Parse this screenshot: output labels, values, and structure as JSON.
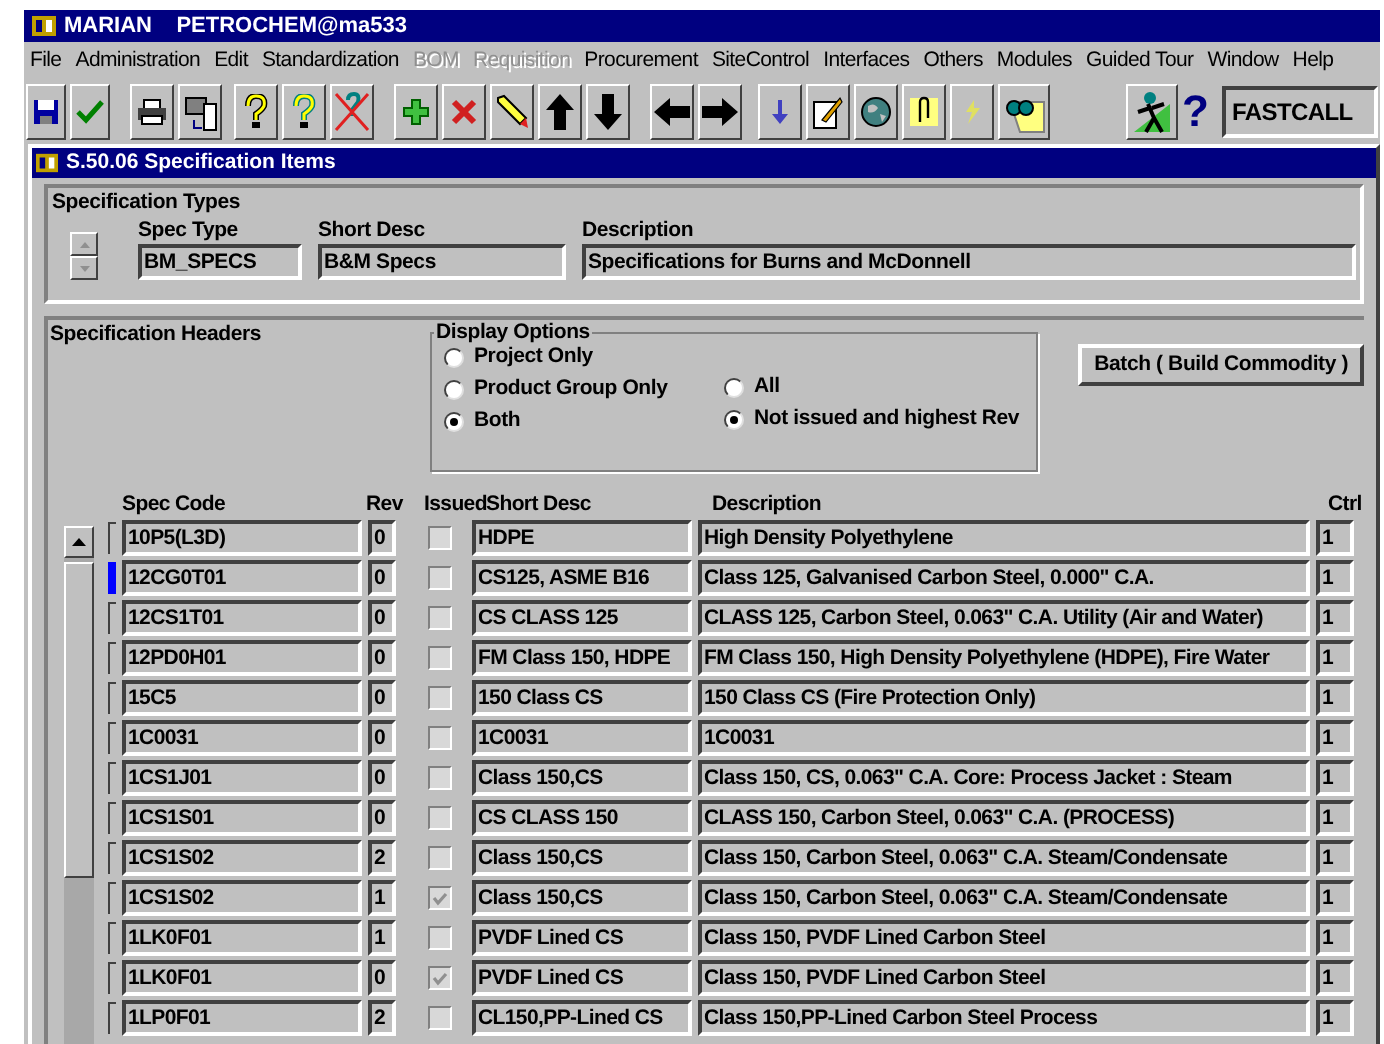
{
  "window": {
    "title": "MARIAN    PETROCHEM@ma533"
  },
  "menu": [
    {
      "label": "File",
      "disabled": false
    },
    {
      "label": "Administration",
      "disabled": false
    },
    {
      "label": "Edit",
      "disabled": false
    },
    {
      "label": "Standardization",
      "disabled": false
    },
    {
      "label": "BOM",
      "disabled": true
    },
    {
      "label": "Requisition",
      "disabled": true
    },
    {
      "label": "Procurement",
      "disabled": false
    },
    {
      "label": "SiteControl",
      "disabled": false
    },
    {
      "label": "Interfaces",
      "disabled": false
    },
    {
      "label": "Others",
      "disabled": false
    },
    {
      "label": "Modules",
      "disabled": false
    },
    {
      "label": "Guided Tour",
      "disabled": false
    },
    {
      "label": "Window",
      "disabled": false
    },
    {
      "label": "Help",
      "disabled": false
    }
  ],
  "toolbar": {
    "help_glyph": "?",
    "fastcall": "FASTCALL"
  },
  "form": {
    "title": "S.50.06 Specification Items",
    "spec_types": {
      "title": "Specification Types",
      "spec_type_label": "Spec Type",
      "spec_type": "BM_SPECS",
      "short_desc_label": "Short Desc",
      "short_desc": "B&M Specs",
      "description_label": "Description",
      "description": "Specifications for Burns and McDonnell"
    },
    "spec_headers": {
      "title": "Specification Headers",
      "display_options": {
        "title": "Display Options",
        "scope": [
          {
            "label": "Project Only",
            "selected": false
          },
          {
            "label": "Product Group Only",
            "selected": false
          },
          {
            "label": "Both",
            "selected": true
          }
        ],
        "issue": [
          {
            "label": "All",
            "selected": false
          },
          {
            "label": "Not issued and highest Rev",
            "selected": true
          }
        ]
      },
      "batch_button": "Batch ( Build Commodity )"
    },
    "table": {
      "columns": [
        "Spec Code",
        "Rev",
        "Issued",
        "Short Desc",
        "Description",
        "Ctrl"
      ],
      "rows": [
        {
          "spec_code": "10P5(L3D)",
          "rev": "0",
          "issued": false,
          "short_desc": "HDPE",
          "description": "High Density Polyethylene",
          "ctrl": "1",
          "selected": false
        },
        {
          "spec_code": "12CG0T01",
          "rev": "0",
          "issued": false,
          "short_desc": "CS125, ASME B16",
          "description": "Class 125, Galvanised Carbon Steel, 0.000\" C.A.",
          "ctrl": "1",
          "selected": true
        },
        {
          "spec_code": "12CS1T01",
          "rev": "0",
          "issued": false,
          "short_desc": "CS CLASS 125",
          "description": "CLASS 125, Carbon Steel, 0.063\" C.A. Utility (Air and Water)",
          "ctrl": "1",
          "selected": false
        },
        {
          "spec_code": "12PD0H01",
          "rev": "0",
          "issued": false,
          "short_desc": "FM Class 150, HDPE",
          "description": "FM Class 150, High Density Polyethylene (HDPE), Fire Water",
          "ctrl": "1",
          "selected": false
        },
        {
          "spec_code": "15C5",
          "rev": "0",
          "issued": false,
          "short_desc": "150 Class CS",
          "description": "150 Class CS (Fire Protection Only)",
          "ctrl": "1",
          "selected": false
        },
        {
          "spec_code": "1C0031",
          "rev": "0",
          "issued": false,
          "short_desc": "1C0031",
          "description": "1C0031",
          "ctrl": "1",
          "selected": false
        },
        {
          "spec_code": "1CS1J01",
          "rev": "0",
          "issued": false,
          "short_desc": "Class 150,CS",
          "description": "Class 150, CS, 0.063\" C.A. Core: Process Jacket : Steam",
          "ctrl": "1",
          "selected": false
        },
        {
          "spec_code": "1CS1S01",
          "rev": "0",
          "issued": false,
          "short_desc": "CS CLASS 150",
          "description": "CLASS 150, Carbon Steel, 0.063\" C.A. (PROCESS)",
          "ctrl": "1",
          "selected": false
        },
        {
          "spec_code": "1CS1S02",
          "rev": "2",
          "issued": false,
          "short_desc": "Class 150,CS",
          "description": "Class 150, Carbon Steel, 0.063\" C.A. Steam/Condensate",
          "ctrl": "1",
          "selected": false
        },
        {
          "spec_code": "1CS1S02",
          "rev": "1",
          "issued": true,
          "short_desc": "Class 150,CS",
          "description": "Class 150, Carbon Steel, 0.063\" C.A. Steam/Condensate",
          "ctrl": "1",
          "selected": false
        },
        {
          "spec_code": "1LK0F01",
          "rev": "1",
          "issued": false,
          "short_desc": "PVDF Lined CS",
          "description": "Class 150, PVDF Lined Carbon Steel",
          "ctrl": "1",
          "selected": false
        },
        {
          "spec_code": "1LK0F01",
          "rev": "0",
          "issued": true,
          "short_desc": "PVDF Lined CS",
          "description": "Class 150, PVDF Lined Carbon Steel",
          "ctrl": "1",
          "selected": false
        },
        {
          "spec_code": "1LP0F01",
          "rev": "2",
          "issued": false,
          "short_desc": "CL150,PP-Lined CS",
          "description": "Class 150,PP-Lined Carbon Steel Process",
          "ctrl": "1",
          "selected": false
        }
      ]
    }
  }
}
